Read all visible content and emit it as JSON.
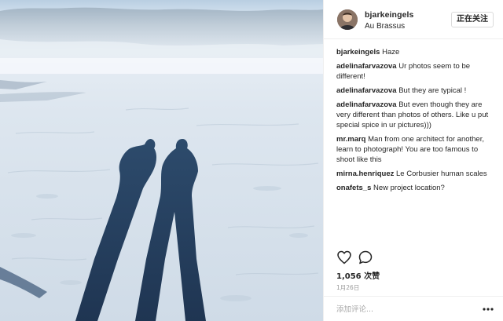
{
  "post": {
    "image_alt": "Two long shadows of people on a snow-covered frozen lake"
  },
  "header": {
    "username": "bjarkeingels",
    "location": "Au Brassus",
    "follow_label": "正在关注"
  },
  "comments": [
    {
      "author": "bjarkeingels",
      "text": "Haze"
    },
    {
      "author": "adelinafarvazova",
      "text": "Ur photos seem to be different!"
    },
    {
      "author": "adelinafarvazova",
      "text": "But they are typical !"
    },
    {
      "author": "adelinafarvazova",
      "text": "But even though they are very different than photos of others. Like u put special spice in ur pictures)))"
    },
    {
      "author": "mr.marq",
      "text": "Man from one architect for another, learn to photograph! You are too famous to shoot like this"
    },
    {
      "author": "mirna.henriquez",
      "text": "Le Corbusier human scales"
    },
    {
      "author": "onafets_s",
      "text": "New project location?"
    }
  ],
  "actions": {
    "like_icon": "heart-icon",
    "comment_icon": "comment-bubble-icon"
  },
  "likes_text": "1,056 次赞",
  "date_text": "1月26日",
  "comment_box": {
    "placeholder": "添加评论...",
    "more_icon": "ellipsis-icon"
  }
}
